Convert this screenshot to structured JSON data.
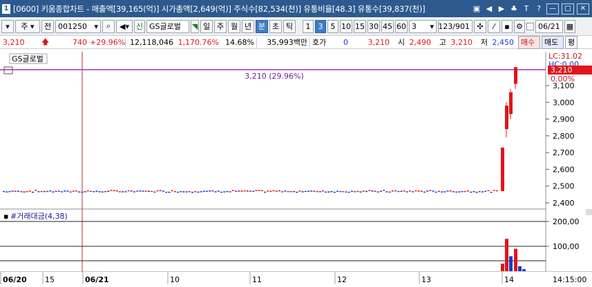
{
  "titlebar": {
    "code_badge": "1",
    "title": "[0600] 키움종합차트 - 매출액[39,165(억)] 시가총액[2,649(억)] 주식수[82,534(천)] 유통비율[48.3] 유통수[39,837(천)]",
    "tools": [
      "▣",
      "◀",
      "▶",
      "♣",
      "T",
      "?"
    ],
    "window": [
      "—",
      "□",
      "✕"
    ]
  },
  "toolbar": {
    "period_type": "주",
    "all_label": "전",
    "code": "001250",
    "stock_badge": "신",
    "stock_name": "GS글로벌",
    "periods": [
      "일",
      "주",
      "월",
      "년",
      "분",
      "초",
      "틱"
    ],
    "selected_period": "분",
    "intervals": [
      "1",
      "3",
      "5",
      "10",
      "15",
      "30",
      "45",
      "60"
    ],
    "selected_interval": "3",
    "interval_value": "3",
    "count": "123/901",
    "date": "06/21"
  },
  "quote": {
    "price": "3,210",
    "change": "740",
    "rate": "+29.96%",
    "volume": "12,118,046",
    "vol_rate": "1,170.76%",
    "turnover": "14.68%",
    "amount": "35,993백만",
    "hoga_label": "호가",
    "hoga_value": "0",
    "cur": "3,210",
    "open_label": "시",
    "open": "2,490",
    "high_label": "고",
    "high": "3,210",
    "low_label": "저",
    "low": "2,450",
    "buy": "매수",
    "sell": "매도",
    "eval": "평"
  },
  "price_panel": {
    "name": "GS글로벌",
    "callout": "3,210 (29.96%)",
    "lc": "LC:31.02",
    "hc": "HC:0.00",
    "current_tag": "3,210",
    "pct_tag": "0.00%",
    "colors": {
      "up": "#e0161b",
      "down": "#1a3ccc",
      "line": "#9b30c8"
    }
  },
  "volume_panel": {
    "name": "#거래대금(4,38)",
    "ticks": [
      "200,00",
      "100,00"
    ]
  },
  "xaxis": {
    "labels": [
      "06/20",
      "15",
      "06/21",
      "10",
      "11",
      "12",
      "13",
      "14"
    ],
    "time": "14:15:00"
  },
  "chart_data": {
    "type": "candlestick",
    "price_ticks": [
      3100,
      3000,
      2900,
      2800,
      2700,
      2600,
      2500,
      2400
    ],
    "ylim": [
      2370,
      3240
    ],
    "base_price": 2470,
    "spike_candles": [
      {
        "o": 2470,
        "c": 2730,
        "h": 2730,
        "l": 2470
      },
      {
        "o": 2840,
        "c": 2980,
        "h": 3000,
        "l": 2790
      },
      {
        "o": 2930,
        "c": 3060,
        "h": 3080,
        "l": 2900
      },
      {
        "o": 3110,
        "c": 3210,
        "h": 3210,
        "l": 3080
      }
    ],
    "volume_ticks": [
      200,
      100
    ],
    "volume_bars": [
      {
        "v": 30,
        "color": "#e0161b"
      },
      {
        "v": 130,
        "color": "#e0161b"
      },
      {
        "v": 60,
        "color": "#1a3ccc"
      },
      {
        "v": 90,
        "color": "#e0161b"
      },
      {
        "v": 20,
        "color": "#1a3ccc"
      },
      {
        "v": 8,
        "color": "#1a3ccc"
      }
    ]
  }
}
